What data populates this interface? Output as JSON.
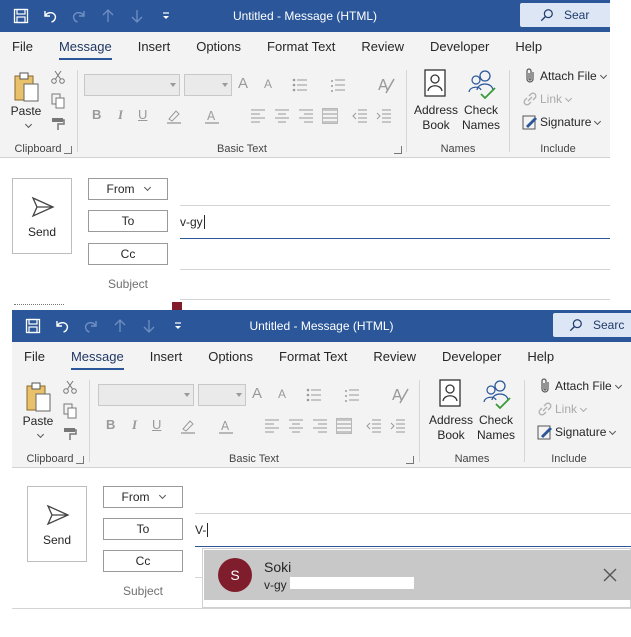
{
  "window": {
    "title": "Untitled  -  Message (HTML)",
    "search_text_top": "Sear",
    "search_text_bottom": "Searc"
  },
  "qat": {
    "icons": [
      "save-icon",
      "undo-icon",
      "redo-icon",
      "up-arrow-icon",
      "down-arrow-icon",
      "customize-qat-icon"
    ]
  },
  "tabs": [
    "File",
    "Message",
    "Insert",
    "Options",
    "Format Text",
    "Review",
    "Developer",
    "Help"
  ],
  "active_tab": "Message",
  "ribbon": {
    "clipboard": {
      "label": "Clipboard",
      "paste": "Paste"
    },
    "basic_text": {
      "label": "Basic Text",
      "grow": "A",
      "shrink": "A",
      "bold": "B",
      "italic": "I",
      "underline": "U"
    },
    "names": {
      "label": "Names",
      "address_book_1": "Address",
      "address_book_2": "Book",
      "check_names_1": "Check",
      "check_names_2": "Names"
    },
    "include": {
      "label": "Include",
      "attach_file": "Attach File",
      "link": "Link",
      "signature": "Signature"
    }
  },
  "compose": {
    "send": "Send",
    "from": "From",
    "to": "To",
    "cc": "Cc",
    "subject": "Subject",
    "to_value_top": "v-gy",
    "to_value_bottom": "V-"
  },
  "suggestion": {
    "initial": "S",
    "name": "Soki",
    "email_prefix": "v-gy",
    "avatar_color": "#7f1d2d"
  },
  "colors": {
    "titlebar": "#2b579a",
    "ribbon_bg": "#f3f3f3",
    "accent": "#2b579a",
    "suggestion_bg": "#c8c8c8"
  }
}
